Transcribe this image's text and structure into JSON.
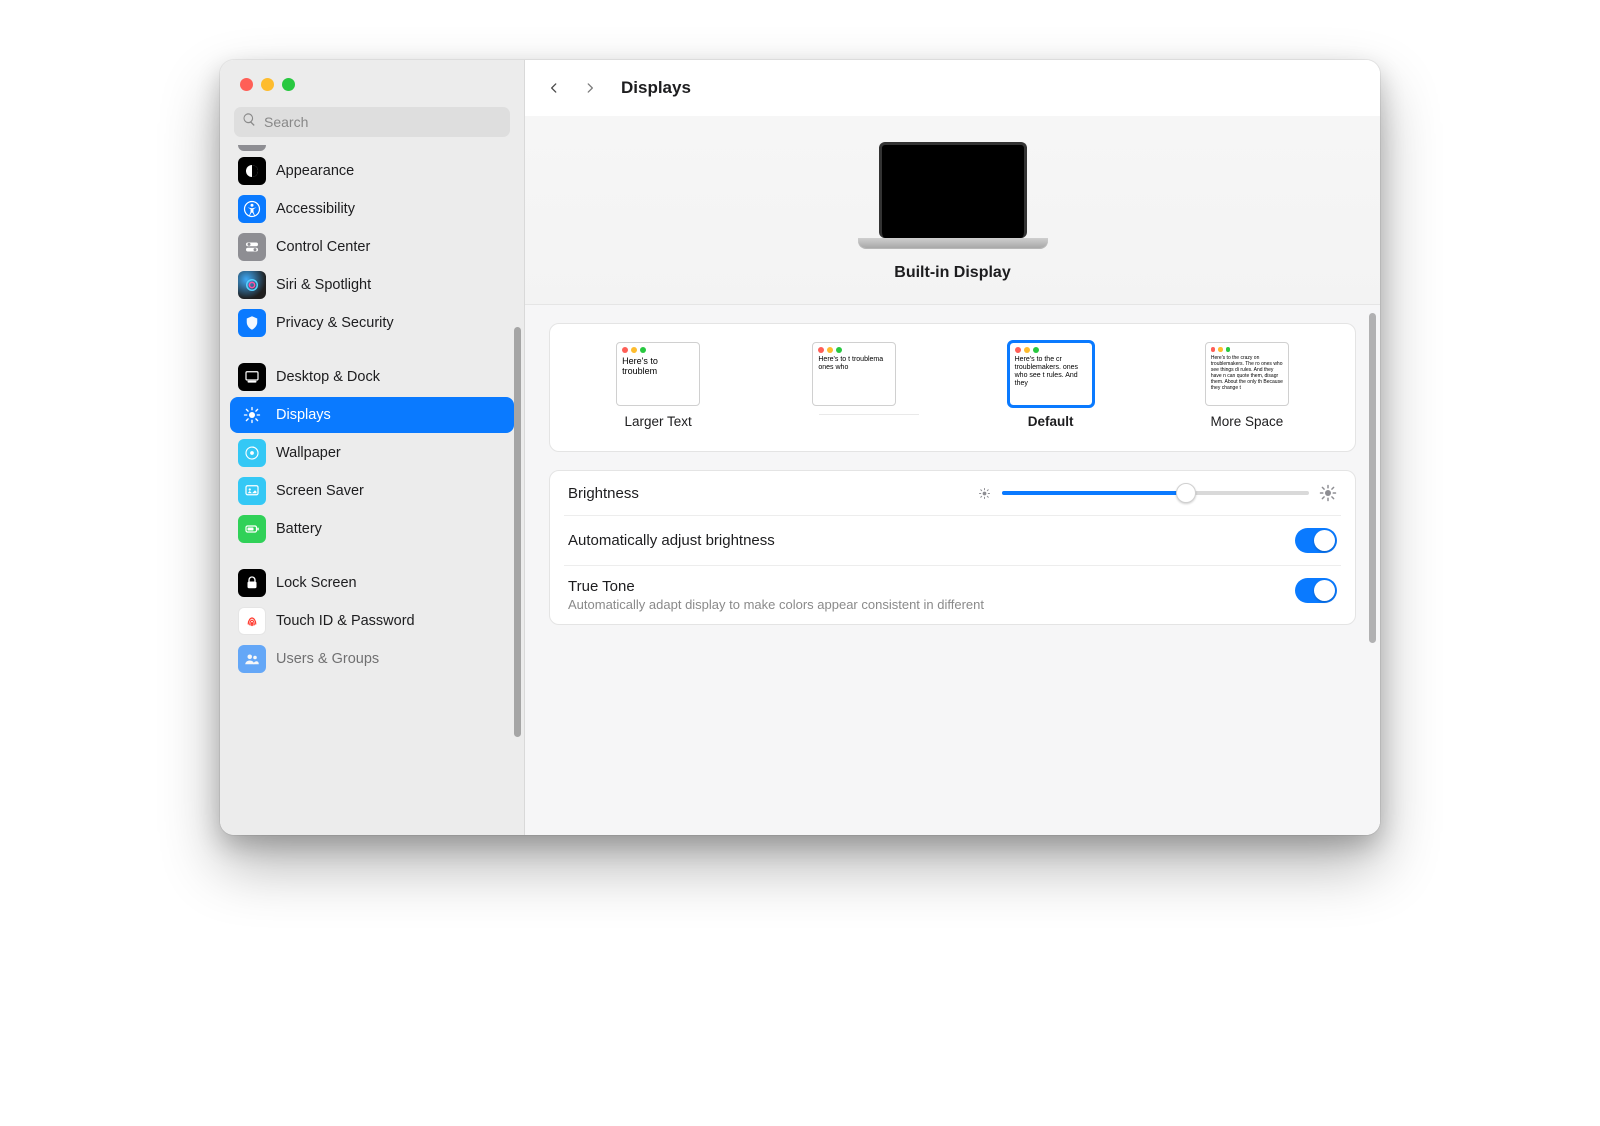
{
  "header": {
    "title": "Displays"
  },
  "search": {
    "placeholder": "Search"
  },
  "sidebar": {
    "items": [
      {
        "label": "Appearance"
      },
      {
        "label": "Accessibility"
      },
      {
        "label": "Control Center"
      },
      {
        "label": "Siri & Spotlight"
      },
      {
        "label": "Privacy & Security"
      },
      {
        "label": "Desktop & Dock"
      },
      {
        "label": "Displays"
      },
      {
        "label": "Wallpaper"
      },
      {
        "label": "Screen Saver"
      },
      {
        "label": "Battery"
      },
      {
        "label": "Lock Screen"
      },
      {
        "label": "Touch ID & Password"
      },
      {
        "label": "Users & Groups"
      }
    ],
    "selected_index": 6
  },
  "display": {
    "name": "Built-in Display"
  },
  "resolutions": {
    "options": [
      {
        "label": "Larger Text",
        "sample": "Here's to troublem"
      },
      {
        "label": "",
        "sample": "Here's to t troublema ones who"
      },
      {
        "label": "Default",
        "sample": "Here's to the cr troublemakers. ones who see t rules. And they",
        "selected": true
      },
      {
        "label": "More Space",
        "sample": "Here's to the crazy on troublemakers. The ro ones who see things di rules. And they have n can quote them, disagr them. About the only th Because they change t"
      }
    ]
  },
  "brightness": {
    "label": "Brightness",
    "value_percent": 60
  },
  "auto_brightness": {
    "label": "Automatically adjust brightness",
    "on": true
  },
  "true_tone": {
    "label": "True Tone",
    "description": "Automatically adapt display to make colors appear consistent in different",
    "on": true
  }
}
